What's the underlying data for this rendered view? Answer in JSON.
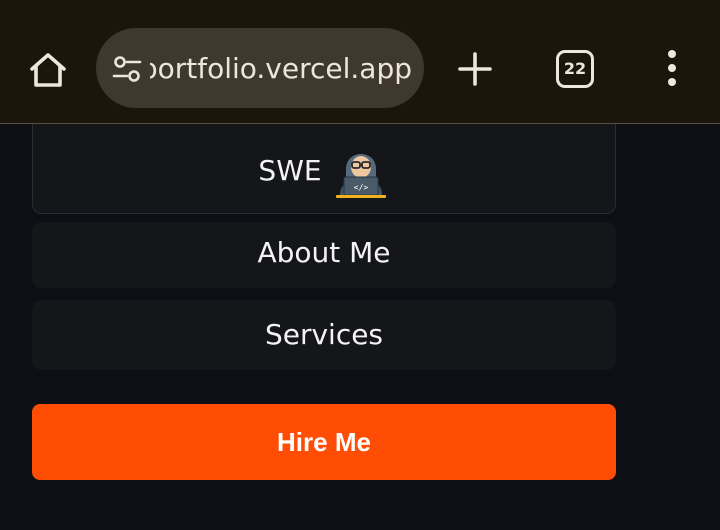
{
  "browser": {
    "url": "portfolio.vercel.app",
    "tab_count": "22",
    "icons": [
      "home-icon",
      "site-settings-icon",
      "plus-icon",
      "tab-switcher-icon",
      "more-vert-icon"
    ]
  },
  "menu": {
    "items": [
      {
        "label": "SWE",
        "icon": "hacker-laptop-icon"
      },
      {
        "label": "About Me"
      },
      {
        "label": "Services"
      }
    ],
    "hire_label": "Hire Me"
  },
  "colors": {
    "toolbar": "#1c150c",
    "url_pill": "#3f382c",
    "page_bg": "#0d0f14",
    "card_bg": "#14161a",
    "accent": "#ff4d06"
  }
}
